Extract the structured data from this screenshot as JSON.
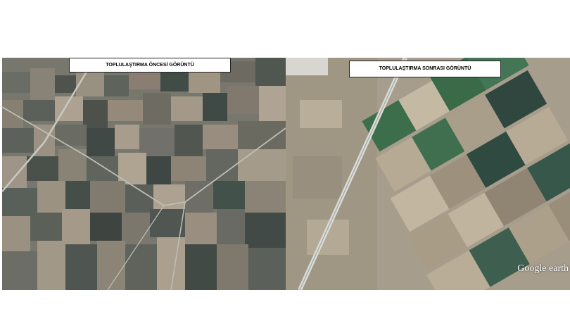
{
  "panels": {
    "before": {
      "label": "TOPLULAŞTIRMA ÖNCESİ GÖRÜNTÜ"
    },
    "after": {
      "label": "TOPLULAŞTIRMA SONRASI GÖRÜNTÜ",
      "watermark": "Google earth"
    }
  },
  "colors": {
    "field_dark": "#3e4a45",
    "field_mid": "#7d7d74",
    "field_light": "#b2a99a",
    "field_green": "#3c6c4c",
    "field_pale": "#c9bea9",
    "road": "#cfd2cc"
  }
}
